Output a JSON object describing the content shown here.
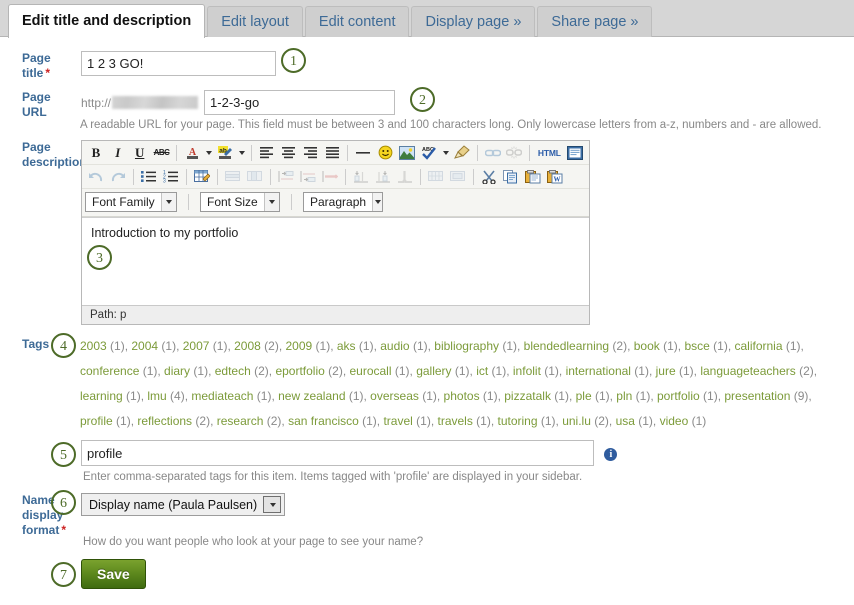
{
  "tabs": [
    {
      "label": "Edit title and description",
      "active": true
    },
    {
      "label": "Edit layout",
      "active": false
    },
    {
      "label": "Edit content",
      "active": false
    },
    {
      "label": "Display page »",
      "active": false
    },
    {
      "label": "Share page »",
      "active": false
    }
  ],
  "fields": {
    "page_title": {
      "label": "Page title",
      "required": "*",
      "value": "1 2 3 GO!",
      "placeholder": ""
    },
    "page_url": {
      "label": "Page URL",
      "protocol": "http://",
      "value": "1-2-3-go",
      "placeholder": "",
      "help": "A readable URL for your page. This field must be between 3 and 100 characters long. Only lowercase letters from a-z, numbers and - are allowed."
    },
    "page_description": {
      "label_line1": "Page",
      "label_line2": "description",
      "content": "Introduction to my portfolio",
      "status": "Path: p"
    },
    "tags": {
      "label": "Tags",
      "value": "profile",
      "placeholder": "",
      "help": "Enter comma-separated tags for this item. Items tagged with 'profile' are displayed in your sidebar."
    },
    "name_display_format": {
      "label_line1": "Name",
      "label_line2": "display",
      "label_line3": "format",
      "required": "*",
      "selected": "Display name (Paula Paulsen)",
      "help": "How do you want people who look at your page to see your name?"
    }
  },
  "editor": {
    "toolbar_row1": [
      {
        "name": "bold-icon",
        "glyph": "B",
        "style": "bold-serif",
        "disabled": false
      },
      {
        "name": "italic-icon",
        "glyph": "I",
        "style": "italic-serif",
        "disabled": false
      },
      {
        "name": "underline-icon",
        "glyph": "U",
        "style": "underline-serif",
        "disabled": false
      },
      {
        "name": "strikethrough-icon",
        "glyph": "ABC",
        "style": "strike-tiny",
        "disabled": false
      },
      {
        "name": "separator",
        "glyph": "",
        "style": "sep",
        "disabled": false
      },
      {
        "name": "text-color-icon",
        "glyph": "A",
        "style": "color-a",
        "disabled": false
      },
      {
        "name": "text-color-dropdown-icon",
        "glyph": "",
        "style": "caret",
        "disabled": false
      },
      {
        "name": "background-color-icon",
        "glyph": "ab",
        "style": "color-ab",
        "disabled": false
      },
      {
        "name": "background-color-dropdown-icon",
        "glyph": "",
        "style": "caret",
        "disabled": false
      },
      {
        "name": "separator",
        "glyph": "",
        "style": "sep",
        "disabled": false
      },
      {
        "name": "align-left-icon",
        "glyph": "",
        "style": "align-left",
        "disabled": false
      },
      {
        "name": "align-center-icon",
        "glyph": "",
        "style": "align-center",
        "disabled": false
      },
      {
        "name": "align-right-icon",
        "glyph": "",
        "style": "align-right",
        "disabled": false
      },
      {
        "name": "align-justify-icon",
        "glyph": "",
        "style": "align-justify",
        "disabled": false
      },
      {
        "name": "separator",
        "glyph": "",
        "style": "sep",
        "disabled": false
      },
      {
        "name": "horizontal-rule-icon",
        "glyph": "",
        "style": "hr",
        "disabled": false
      },
      {
        "name": "emoticon-icon",
        "glyph": "🙂",
        "style": "emoji-smile",
        "disabled": false
      },
      {
        "name": "insert-image-icon",
        "glyph": "",
        "style": "image",
        "disabled": false
      },
      {
        "name": "spellcheck-icon",
        "glyph": "",
        "style": "spell",
        "disabled": false
      },
      {
        "name": "spellcheck-dropdown-icon",
        "glyph": "",
        "style": "caret",
        "disabled": false
      },
      {
        "name": "cleanup-icon",
        "glyph": "",
        "style": "broom",
        "disabled": false
      },
      {
        "name": "separator",
        "glyph": "",
        "style": "sep",
        "disabled": false
      },
      {
        "name": "insert-link-icon",
        "glyph": "",
        "style": "link",
        "disabled": true
      },
      {
        "name": "unlink-icon",
        "glyph": "",
        "style": "unlink",
        "disabled": true
      },
      {
        "name": "separator",
        "glyph": "",
        "style": "sep",
        "disabled": false
      },
      {
        "name": "edit-html-source-icon",
        "glyph": "HTML",
        "style": "html",
        "disabled": false
      },
      {
        "name": "fullscreen-icon",
        "glyph": "",
        "style": "fullscreen",
        "disabled": false
      }
    ],
    "toolbar_row2": [
      {
        "name": "undo-icon",
        "glyph": "↶",
        "style": "undo",
        "disabled": true
      },
      {
        "name": "redo-icon",
        "glyph": "↷",
        "style": "redo",
        "disabled": true
      },
      {
        "name": "separator",
        "glyph": "",
        "style": "sep",
        "disabled": false
      },
      {
        "name": "bullet-list-icon",
        "glyph": "",
        "style": "ul",
        "disabled": false
      },
      {
        "name": "numbered-list-icon",
        "glyph": "",
        "style": "ol",
        "disabled": false
      },
      {
        "name": "separator",
        "glyph": "",
        "style": "sep",
        "disabled": false
      },
      {
        "name": "insert-table-icon",
        "glyph": "",
        "style": "table-edit",
        "disabled": false
      },
      {
        "name": "separator",
        "glyph": "",
        "style": "sep",
        "disabled": false
      },
      {
        "name": "table-row-properties-icon",
        "glyph": "",
        "style": "row-prop",
        "disabled": true
      },
      {
        "name": "table-cell-properties-icon",
        "glyph": "",
        "style": "cell-prop",
        "disabled": true
      },
      {
        "name": "separator",
        "glyph": "",
        "style": "sep",
        "disabled": false
      },
      {
        "name": "insert-row-before-icon",
        "glyph": "",
        "style": "row-before",
        "disabled": true
      },
      {
        "name": "insert-row-after-icon",
        "glyph": "",
        "style": "row-after",
        "disabled": true
      },
      {
        "name": "delete-row-icon",
        "glyph": "",
        "style": "row-del",
        "disabled": true
      },
      {
        "name": "separator",
        "glyph": "",
        "style": "sep",
        "disabled": false
      },
      {
        "name": "insert-column-before-icon",
        "glyph": "",
        "style": "col-before",
        "disabled": true
      },
      {
        "name": "insert-column-after-icon",
        "glyph": "",
        "style": "col-after",
        "disabled": true
      },
      {
        "name": "delete-column-icon",
        "glyph": "",
        "style": "col-del",
        "disabled": true
      },
      {
        "name": "separator",
        "glyph": "",
        "style": "sep",
        "disabled": false
      },
      {
        "name": "split-table-cells-icon",
        "glyph": "",
        "style": "split-cells",
        "disabled": true
      },
      {
        "name": "merge-table-cells-icon",
        "glyph": "",
        "style": "merge-cells",
        "disabled": true
      },
      {
        "name": "separator",
        "glyph": "",
        "style": "sep",
        "disabled": false
      },
      {
        "name": "cut-icon",
        "glyph": "✂",
        "style": "cut",
        "disabled": false
      },
      {
        "name": "copy-icon",
        "glyph": "",
        "style": "copy",
        "disabled": false
      },
      {
        "name": "paste-icon",
        "glyph": "",
        "style": "paste",
        "disabled": false
      },
      {
        "name": "paste-from-word-icon",
        "glyph": "W",
        "style": "paste-word",
        "disabled": false
      }
    ],
    "selects": [
      {
        "name": "font-family-select",
        "label": "Font Family"
      },
      {
        "name": "font-size-select",
        "label": "Font Size"
      },
      {
        "name": "paragraph-format-select",
        "label": "Paragraph"
      }
    ]
  },
  "tag_cloud": [
    {
      "tag": "2003",
      "count": "(1)"
    },
    {
      "tag": "2004",
      "count": "(1)"
    },
    {
      "tag": "2007",
      "count": "(1)"
    },
    {
      "tag": "2008",
      "count": "(2)"
    },
    {
      "tag": "2009",
      "count": "(1)"
    },
    {
      "tag": "aks",
      "count": "(1)"
    },
    {
      "tag": "audio",
      "count": "(1)"
    },
    {
      "tag": "bibliography",
      "count": "(1)"
    },
    {
      "tag": "blendedlearning",
      "count": "(2)"
    },
    {
      "tag": "book",
      "count": "(1)"
    },
    {
      "tag": "bsce",
      "count": "(1)"
    },
    {
      "tag": "california",
      "count": "(1)"
    },
    {
      "tag": "conference",
      "count": "(1)"
    },
    {
      "tag": "diary",
      "count": "(1)"
    },
    {
      "tag": "edtech",
      "count": "(2)"
    },
    {
      "tag": "eportfolio",
      "count": "(2)"
    },
    {
      "tag": "eurocall",
      "count": "(1)"
    },
    {
      "tag": "gallery",
      "count": "(1)"
    },
    {
      "tag": "ict",
      "count": "(1)"
    },
    {
      "tag": "infolit",
      "count": "(1)"
    },
    {
      "tag": "international",
      "count": "(1)"
    },
    {
      "tag": "jure",
      "count": "(1)"
    },
    {
      "tag": "languageteachers",
      "count": "(2)"
    },
    {
      "tag": "learning",
      "count": "(1)"
    },
    {
      "tag": "lmu",
      "count": "(4)"
    },
    {
      "tag": "mediateach",
      "count": "(1)"
    },
    {
      "tag": "new zealand",
      "count": "(1)"
    },
    {
      "tag": "overseas",
      "count": "(1)"
    },
    {
      "tag": "photos",
      "count": "(1)"
    },
    {
      "tag": "pizzatalk",
      "count": "(1)"
    },
    {
      "tag": "ple",
      "count": "(1)"
    },
    {
      "tag": "pln",
      "count": "(1)"
    },
    {
      "tag": "portfolio",
      "count": "(1)"
    },
    {
      "tag": "presentation",
      "count": "(9)"
    },
    {
      "tag": "profile",
      "count": "(1)"
    },
    {
      "tag": "reflections",
      "count": "(2)"
    },
    {
      "tag": "research",
      "count": "(2)"
    },
    {
      "tag": "san francisco",
      "count": "(1)"
    },
    {
      "tag": "travel",
      "count": "(1)"
    },
    {
      "tag": "travels",
      "count": "(1)"
    },
    {
      "tag": "tutoring",
      "count": "(1)"
    },
    {
      "tag": "uni.lu",
      "count": "(2)"
    },
    {
      "tag": "usa",
      "count": "(1)"
    },
    {
      "tag": "video",
      "count": "(1)"
    }
  ],
  "buttons": {
    "save_label": "Save"
  },
  "annotations": {
    "b1": "1",
    "b2": "2",
    "b3": "3",
    "b4": "4",
    "b5": "5",
    "b6": "6",
    "b7": "7"
  },
  "colors": {
    "tab_link": "#3d6a96",
    "label": "#3d6a96",
    "tag_link": "#7c9b3a",
    "annotation": "#4d6b28",
    "save_green": "#5f8a1e",
    "required_red": "#cc2222"
  }
}
